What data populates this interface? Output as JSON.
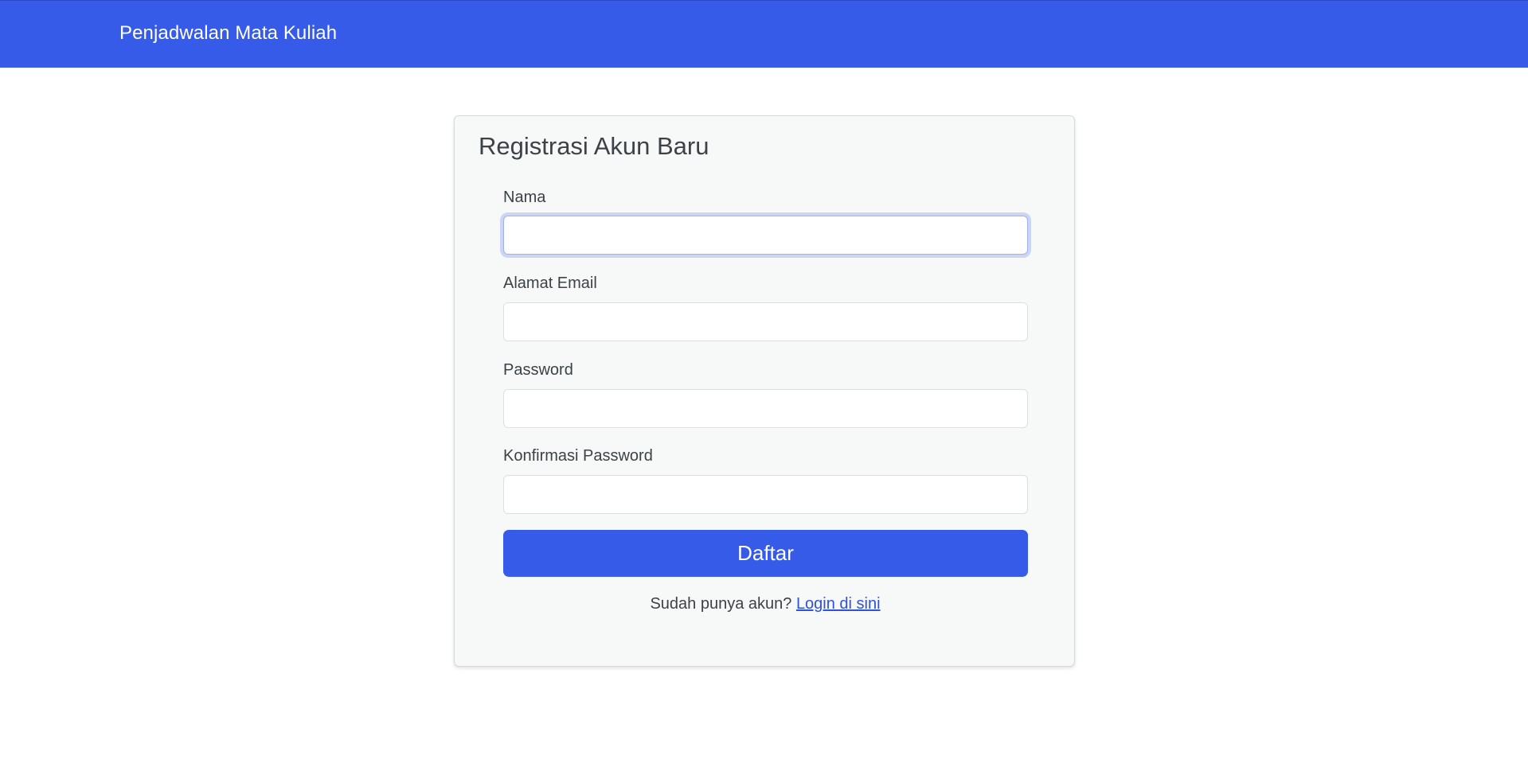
{
  "navbar": {
    "brand": "Penjadwalan Mata Kuliah"
  },
  "form": {
    "title": "Registrasi Akun Baru",
    "fields": [
      {
        "label": "Nama",
        "value": "",
        "placeholder": ""
      },
      {
        "label": "Alamat Email",
        "value": "",
        "placeholder": ""
      },
      {
        "label": "Password",
        "value": "",
        "placeholder": ""
      },
      {
        "label": "Konfirmasi Password",
        "value": "",
        "placeholder": ""
      }
    ],
    "submit_label": "Daftar",
    "login_prompt": "Sudah punya akun?",
    "login_link": "Login di sini"
  },
  "colors": {
    "primary": "#355be8",
    "card_background": "#f7f8f8",
    "text": "#3d4148",
    "link": "#2f52d8"
  }
}
